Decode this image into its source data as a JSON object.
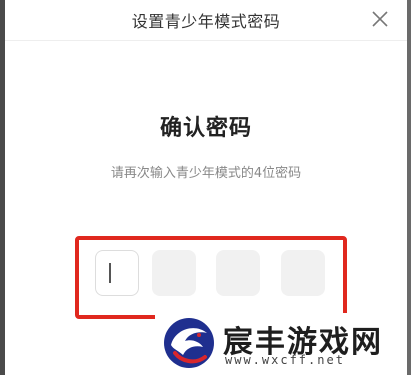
{
  "dialog": {
    "title": "设置青少年模式密码",
    "close_icon": "close-icon"
  },
  "content": {
    "heading": "确认密码",
    "subtitle": "请再次输入青少年模式的4位密码"
  },
  "pin": {
    "length": 4,
    "filled": 0,
    "active_index": 0,
    "highlight_color": "#e0281e"
  },
  "watermark": {
    "name": "宸丰游戏网",
    "url": "www.wxcff.net"
  }
}
